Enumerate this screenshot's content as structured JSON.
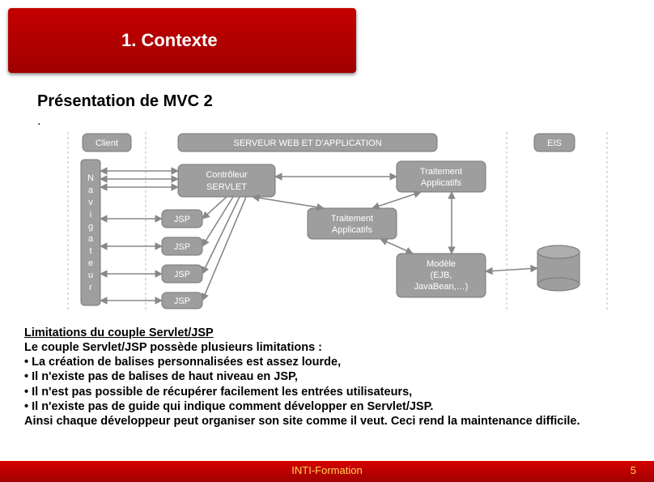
{
  "header": {
    "title": "1. Contexte"
  },
  "subtitle": "Présentation de MVC 2",
  "dot": ".",
  "diagram": {
    "client_label": "Client",
    "server_label": "SERVEUR WEB ET D'APPLICATION",
    "eis_label": "EIS",
    "navigateur_label": "Navigateur",
    "controller_label_1": "Contrôleur",
    "controller_label_2": "SERVLET",
    "jsp_label": "JSP",
    "traitement_label_1": "Traitement",
    "traitement_label_2": "Applicatifs",
    "modele_label_1": "Modèle",
    "modele_label_2": "(EJB,",
    "modele_label_3": "JavaBean,…)",
    "db_label": ""
  },
  "limitations": {
    "heading": "Limitations du couple Servlet/JSP",
    "l1": "Le couple Servlet/JSP possède plusieurs limitations :",
    "l2": "• La création de balises personnalisées est assez lourde,",
    "l3": "• Il n'existe pas de balises de haut niveau en JSP,",
    "l4": "• Il n'est pas possible de récupérer facilement les entrées utilisateurs,",
    "l5": "• Il n'existe pas de guide qui indique comment développer en Servlet/JSP.",
    "l6": "Ainsi chaque développeur peut organiser son site comme il veut. Ceci rend la maintenance difficile."
  },
  "footer": {
    "center": "INTI-Formation",
    "page": "5"
  }
}
